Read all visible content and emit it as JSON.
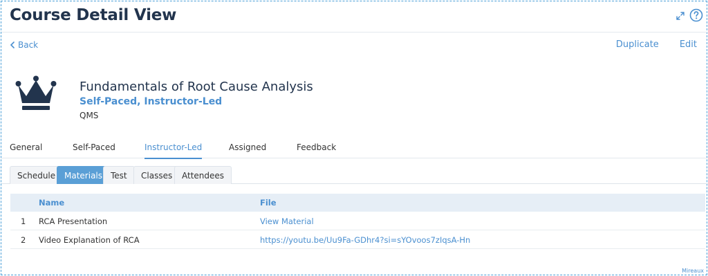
{
  "header": {
    "title": "Course Detail View"
  },
  "nav": {
    "back_label": "Back",
    "duplicate_label": "Duplicate",
    "edit_label": "Edit"
  },
  "course": {
    "title": "Fundamentals of Root Cause Analysis",
    "type": "Self-Paced, Instructor-Led",
    "category": "QMS",
    "icon": "crown-icon"
  },
  "main_tabs": [
    {
      "label": "General"
    },
    {
      "label": "Self-Paced"
    },
    {
      "label": "Instructor-Led"
    },
    {
      "label": "Assigned"
    },
    {
      "label": "Feedback"
    }
  ],
  "active_main_tab": "Instructor-Led",
  "sub_tabs": [
    {
      "label": "Schedule"
    },
    {
      "label": "Materials"
    },
    {
      "label": "Test"
    },
    {
      "label": "Classes"
    },
    {
      "label": "Attendees"
    }
  ],
  "active_sub_tab": "Materials",
  "materials_table": {
    "columns": [
      "Name",
      "File"
    ],
    "rows": [
      {
        "index": "1",
        "name": "RCA Presentation",
        "file": "View Material"
      },
      {
        "index": "2",
        "name": "Video Explanation of RCA",
        "file": "https://youtu.be/Uu9Fa-GDhr4?si=sYOvoos7zIqsA-Hn"
      }
    ]
  },
  "watermark": "Mireaux",
  "colors": {
    "accent": "#4a8fd0",
    "title": "#22344d",
    "active_tab_bg": "#5a9fd6",
    "table_header_bg": "#e6eef6"
  }
}
